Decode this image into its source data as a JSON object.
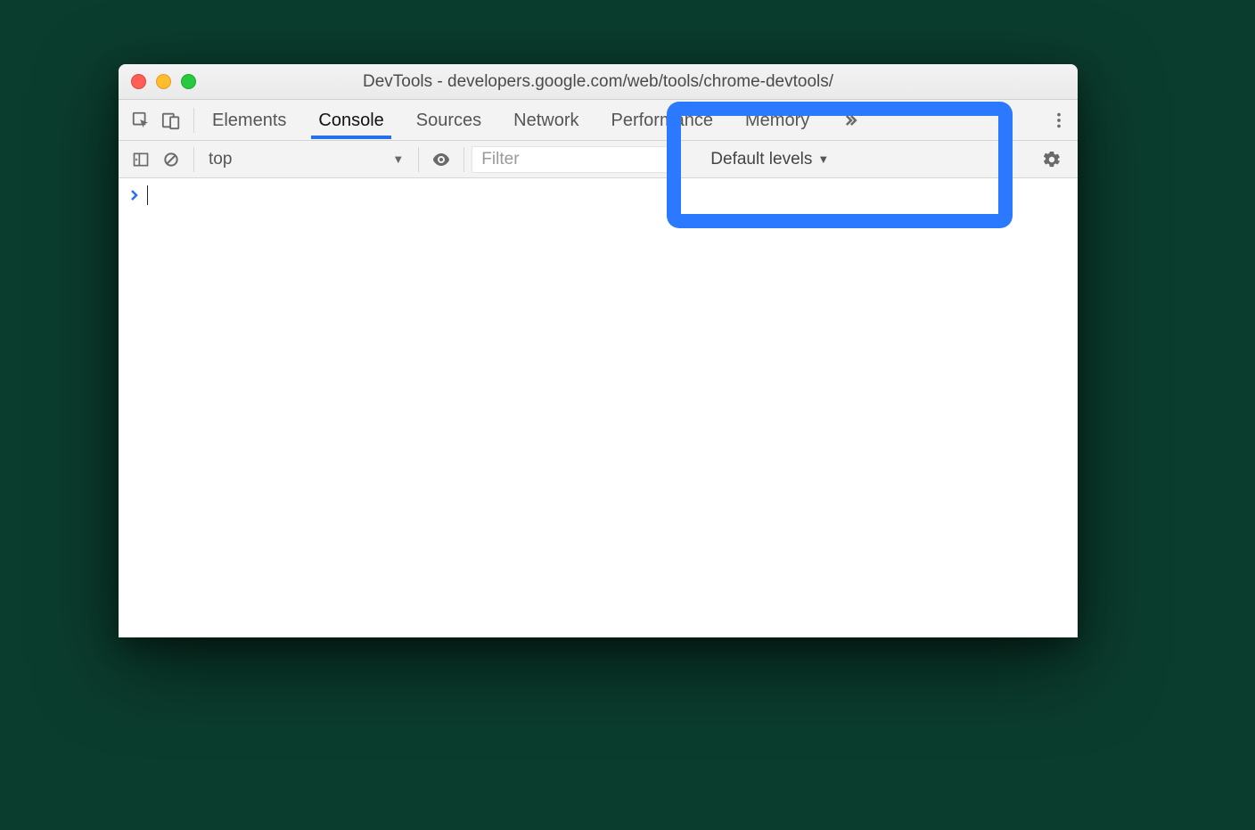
{
  "window": {
    "title": "DevTools - developers.google.com/web/tools/chrome-devtools/"
  },
  "tabs": {
    "items": [
      "Elements",
      "Console",
      "Sources",
      "Network",
      "Performance",
      "Memory"
    ],
    "active": "Console"
  },
  "console_toolbar": {
    "context": "top",
    "filter_placeholder": "Filter",
    "levels_label": "Default levels"
  },
  "icons": {
    "inspect": "inspect-icon",
    "device": "device-toggle-icon",
    "more_tabs": "more-tabs-icon",
    "kebab": "kebab-icon",
    "sidebar": "console-sidebar-icon",
    "clear": "clear-console-icon",
    "eye": "live-expression-icon",
    "gear": "gear-icon",
    "tri": "▼"
  }
}
